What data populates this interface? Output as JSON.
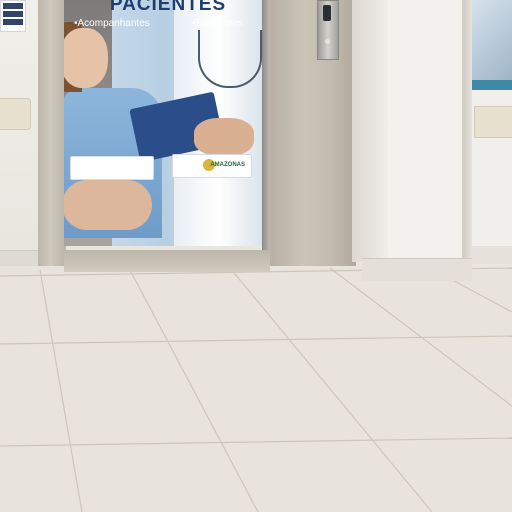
{
  "door_wrap": {
    "title": "PACIENTES",
    "subtitle_left": "•Acompanhantes",
    "subtitle_right": "•Servidores",
    "logo_right_text": "AMAZONAS"
  },
  "colors": {
    "wrap_blue": "#1f3f73",
    "floor_tile": "#e8e3dc",
    "wall": "#f3f1ee",
    "granite": "#c2bbae"
  }
}
